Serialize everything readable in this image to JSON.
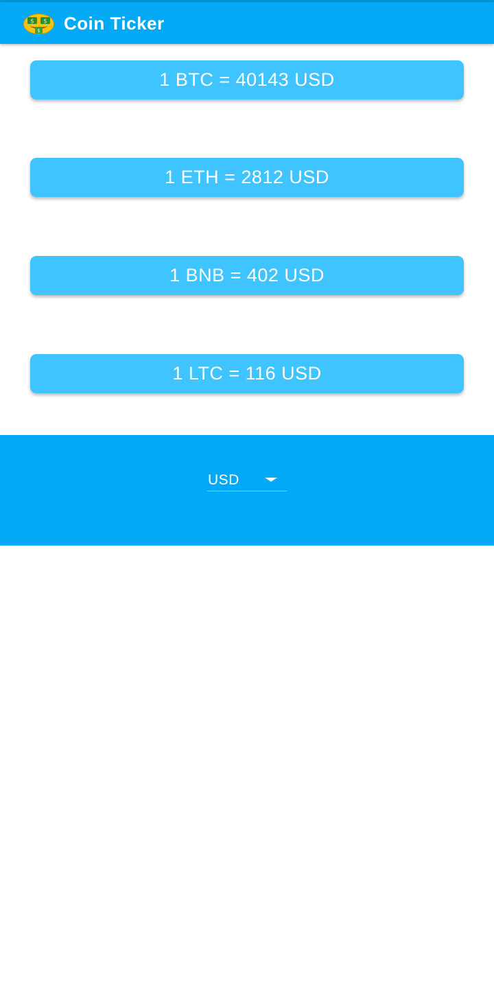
{
  "status_bar": {
    "color": "#0391d6"
  },
  "app_bar": {
    "title": "Coin Ticker",
    "icon": "money-mouth-face-icon",
    "color": "#03a9f4"
  },
  "rates": [
    {
      "coin": "BTC",
      "text": "1 BTC = 40143 USD"
    },
    {
      "coin": "ETH",
      "text": "1 ETH = 2812 USD"
    },
    {
      "coin": "BNB",
      "text": "1 BNB = 402 USD"
    },
    {
      "coin": "LTC",
      "text": "1 LTC = 116 USD"
    }
  ],
  "card_color": "#40c4ff",
  "currency_picker": {
    "selected": "USD",
    "icon": "dropdown-arrow-icon",
    "background": "#03a9f4"
  }
}
